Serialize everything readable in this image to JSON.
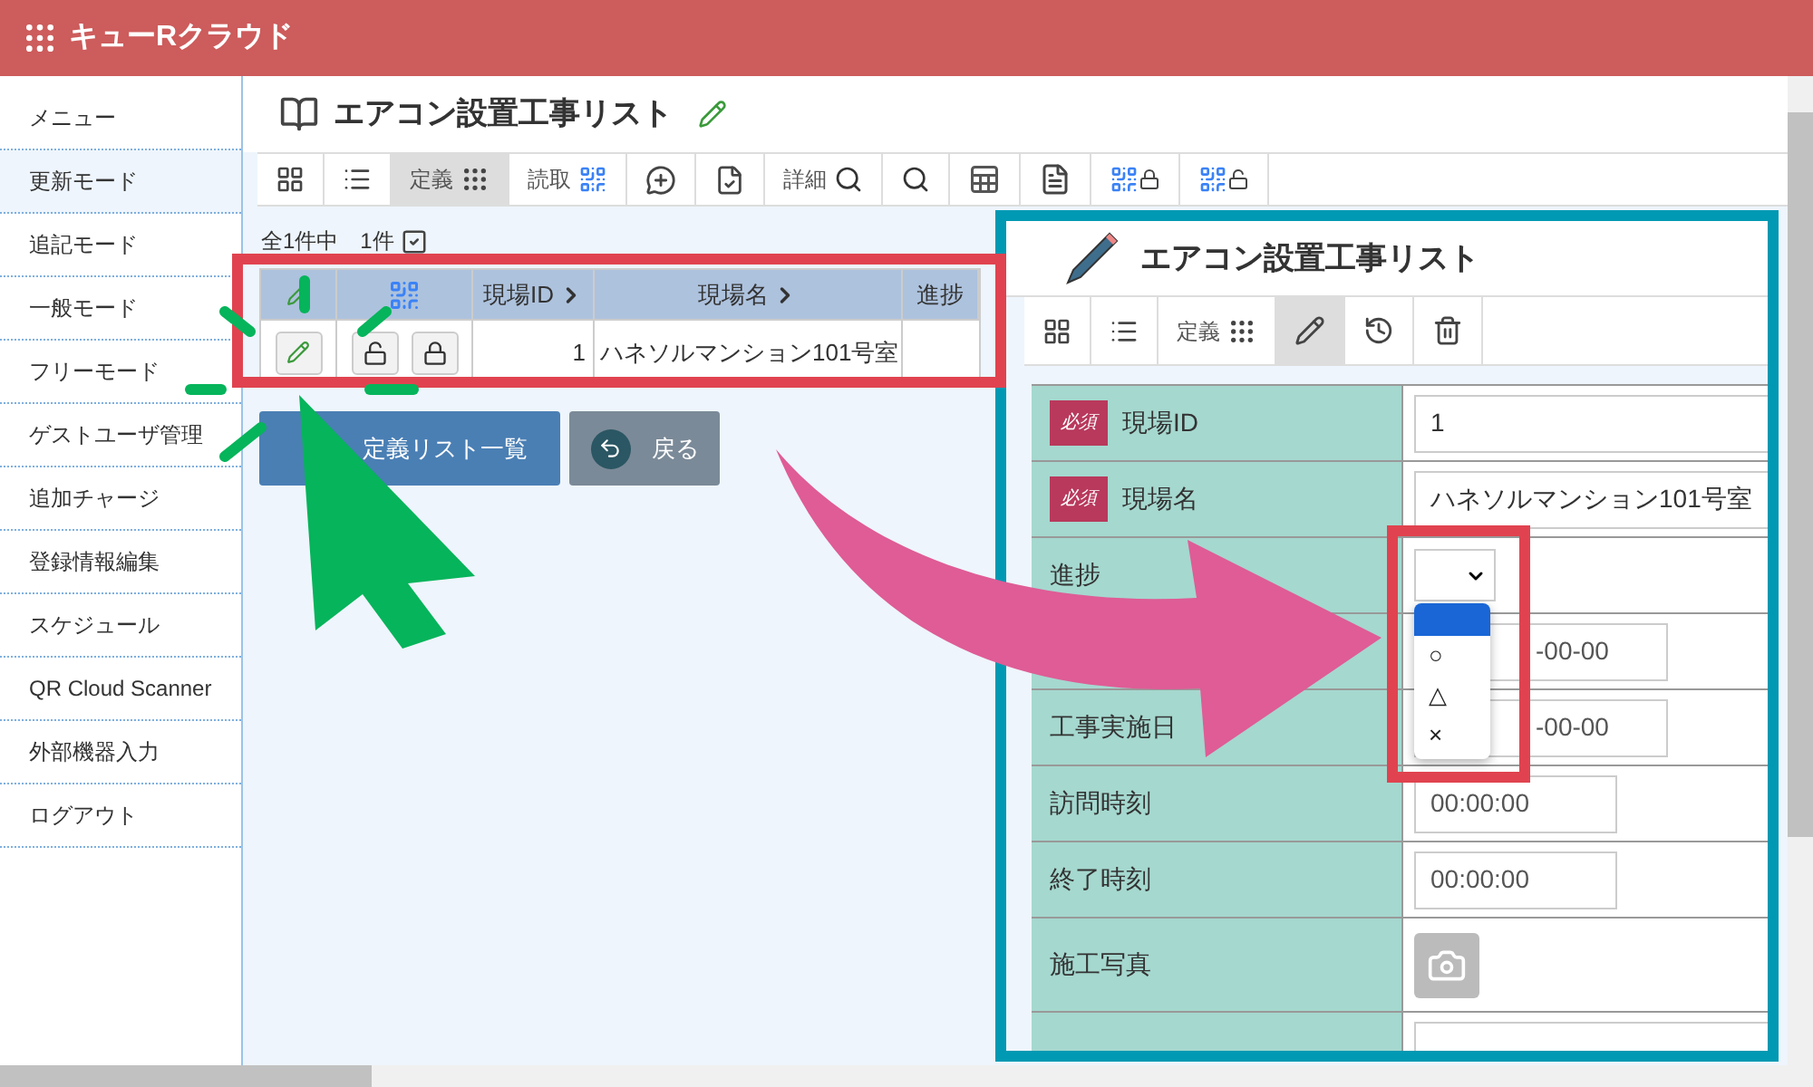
{
  "app": {
    "title": "キューRクラウド"
  },
  "sidebar": {
    "items": [
      {
        "label": "メニュー",
        "selected": false
      },
      {
        "label": "更新モード",
        "selected": true
      },
      {
        "label": "追記モード",
        "selected": false
      },
      {
        "label": "一般モード",
        "selected": false
      },
      {
        "label": "フリーモード",
        "selected": false
      },
      {
        "label": "ゲストユーザ管理",
        "selected": false
      },
      {
        "label": "追加チャージ",
        "selected": false
      },
      {
        "label": "登録情報編集",
        "selected": false
      },
      {
        "label": "スケジュール",
        "selected": false
      },
      {
        "label": "QR Cloud Scanner",
        "selected": false
      },
      {
        "label": "外部機器入力",
        "selected": false
      },
      {
        "label": "ログアウト",
        "selected": false
      }
    ]
  },
  "page": {
    "title": "エアコン設置工事リスト",
    "toolbar": [
      {
        "label": "定義",
        "selected": true
      },
      {
        "label": "読取",
        "selected": false
      },
      {
        "label": "詳細",
        "selected": false
      }
    ],
    "count": "全1件中　1件",
    "table": {
      "columns": [
        "現場ID",
        "現場名",
        "進捗"
      ],
      "rows": [
        {
          "id": "1",
          "name": "ハネソルマンション101号室"
        }
      ]
    },
    "buttons": [
      "定義リスト一覧",
      "戻る"
    ]
  },
  "edit_panel": {
    "title": "エアコン設置工事リスト",
    "toolbar": [
      {
        "label": "定義",
        "selected": false
      }
    ],
    "pencil_selected": true,
    "fields": [
      {
        "kind": "text",
        "label": "現場ID",
        "badge": "必須",
        "value": "1"
      },
      {
        "kind": "text",
        "label": "現場名",
        "badge": "必須",
        "value": "ハネソルマンション101号室"
      },
      {
        "kind": "select",
        "label": "進捗",
        "blank_highlighted": true,
        "options": [
          {
            "label": "○",
            "selected": false
          },
          {
            "label": "△",
            "selected": false
          },
          {
            "label": "×",
            "selected": false
          }
        ]
      },
      {
        "kind": "date",
        "value": "-00-00"
      },
      {
        "kind": "date",
        "label": "工事実施日",
        "value": "-00-00"
      },
      {
        "kind": "time",
        "label": "訪問時刻",
        "value": "00:00:00"
      },
      {
        "kind": "time",
        "label": "終了時刻",
        "value": "00:00:00"
      },
      {
        "kind": "photo",
        "label": "施工写真"
      },
      {
        "kind": "text"
      }
    ]
  }
}
